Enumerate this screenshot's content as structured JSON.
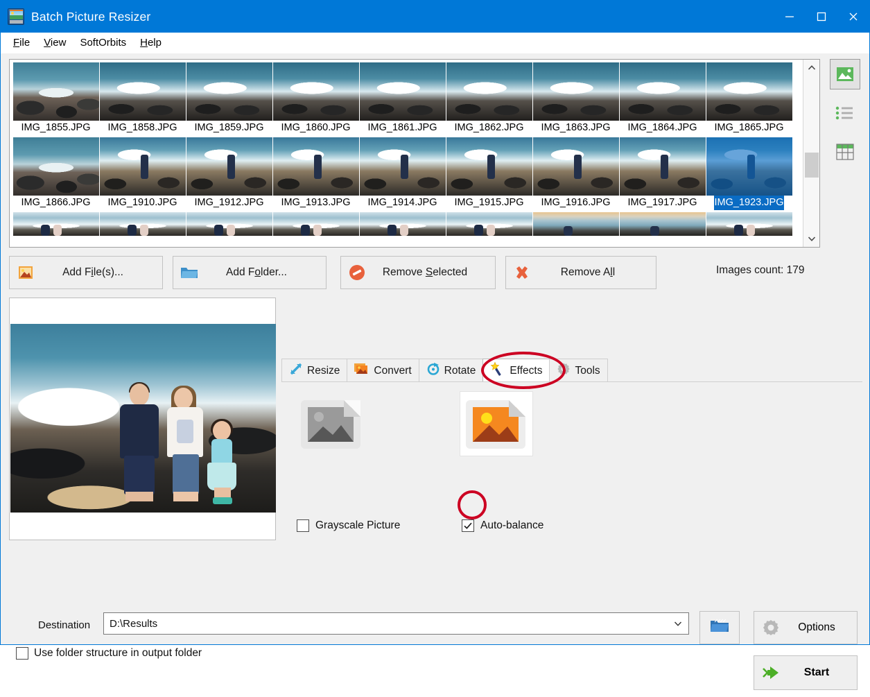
{
  "window": {
    "title": "Batch Picture Resizer",
    "app_icon": "picture-resizer-icon",
    "minimize_label": "Minimize",
    "maximize_label": "Maximize",
    "close_label": "Close",
    "titlebar_color": "#0078d7"
  },
  "menu": {
    "items": [
      {
        "label": "File",
        "accel": "F"
      },
      {
        "label": "View",
        "accel": "V"
      },
      {
        "label": "SoftOrbits",
        "accel": ""
      },
      {
        "label": "Help",
        "accel": "H"
      }
    ]
  },
  "thumbnails": {
    "items": [
      {
        "name": "IMG_1855.JPG",
        "scene": "rocks",
        "selected": false
      },
      {
        "name": "IMG_1858.JPG",
        "scene": "wave",
        "selected": false
      },
      {
        "name": "IMG_1859.JPG",
        "scene": "wave",
        "selected": false
      },
      {
        "name": "IMG_1860.JPG",
        "scene": "wave",
        "selected": false
      },
      {
        "name": "IMG_1861.JPG",
        "scene": "wave",
        "selected": false
      },
      {
        "name": "IMG_1862.JPG",
        "scene": "wave",
        "selected": false
      },
      {
        "name": "IMG_1863.JPG",
        "scene": "wave",
        "selected": false
      },
      {
        "name": "IMG_1864.JPG",
        "scene": "wave",
        "selected": false
      },
      {
        "name": "IMG_1865.JPG",
        "scene": "wave",
        "selected": false
      },
      {
        "name": "IMG_1866.JPG",
        "scene": "rocks",
        "selected": false
      },
      {
        "name": "IMG_1910.JPG",
        "scene": "person",
        "selected": false
      },
      {
        "name": "IMG_1912.JPG",
        "scene": "person",
        "selected": false
      },
      {
        "name": "IMG_1913.JPG",
        "scene": "person",
        "selected": false
      },
      {
        "name": "IMG_1914.JPG",
        "scene": "person",
        "selected": false
      },
      {
        "name": "IMG_1915.JPG",
        "scene": "person",
        "selected": false
      },
      {
        "name": "IMG_1916.JPG",
        "scene": "person",
        "selected": false
      },
      {
        "name": "IMG_1917.JPG",
        "scene": "person",
        "selected": false
      },
      {
        "name": "IMG_1923.JPG",
        "scene": "person",
        "selected": true
      }
    ],
    "partial_row": [
      {
        "name": "",
        "scene": "couple"
      },
      {
        "name": "",
        "scene": "couple"
      },
      {
        "name": "",
        "scene": "couple"
      },
      {
        "name": "",
        "scene": "couple"
      },
      {
        "name": "",
        "scene": "couple"
      },
      {
        "name": "",
        "scene": "couple"
      },
      {
        "name": "",
        "scene": "sunset"
      },
      {
        "name": "",
        "scene": "sunset"
      },
      {
        "name": "",
        "scene": "couple"
      }
    ],
    "selection_color": "#0a6cc4",
    "scrollbar": {
      "up_arrow": "chevron-up-icon",
      "down_arrow": "chevron-down-icon"
    }
  },
  "view_modes": [
    {
      "name": "thumbnail-view",
      "active": true
    },
    {
      "name": "list-view",
      "active": false
    },
    {
      "name": "details-view",
      "active": false
    }
  ],
  "actions": {
    "add_files": {
      "label_pre": "Add F",
      "accel": "i",
      "label_post": "le(s)..."
    },
    "add_folder": {
      "label_pre": "Add F",
      "accel": "o",
      "label_post": "lder..."
    },
    "remove_selected": {
      "label_pre": "Remove ",
      "accel": "S",
      "label_post": "elected"
    },
    "remove_all": {
      "label_pre": "Remove A",
      "accel": "l",
      "label_post": "l"
    },
    "images_count": "Images count: 179"
  },
  "tabs": [
    {
      "label": "Resize",
      "icon": "resize-arrow-icon",
      "active": false
    },
    {
      "label": "Convert",
      "icon": "convert-stack-icon",
      "active": false
    },
    {
      "label": "Rotate",
      "icon": "rotate-circle-icon",
      "active": false
    },
    {
      "label": "Effects",
      "icon": "magic-wand-icon",
      "active": true
    },
    {
      "label": "Tools",
      "icon": "gear-icon",
      "active": false
    }
  ],
  "effects": {
    "grayscale": {
      "label": "Grayscale Picture",
      "checked": false,
      "preview_icon": "grayscale-image-icon"
    },
    "autobalance": {
      "label": "Auto-balance",
      "checked": true,
      "preview_icon": "color-image-icon"
    }
  },
  "bottom": {
    "destination_label": "Destination",
    "destination_value": "D:\\Results",
    "destination_arrow": "chevron-down-icon",
    "browse_icon": "browse-folder-icon",
    "use_folder_structure": {
      "label": "Use folder structure in output folder",
      "checked": false
    },
    "options_button": {
      "label": "Options",
      "icon": "gear-icon"
    },
    "start_button": {
      "label": "Start",
      "icon": "green-arrow-icon"
    }
  },
  "annotations": [
    {
      "name": "effects-tab-highlight",
      "shape": "ellipse",
      "color": "#cc0022"
    },
    {
      "name": "autobalance-checkbox-highlight",
      "shape": "ellipse",
      "color": "#cc0022"
    }
  ]
}
